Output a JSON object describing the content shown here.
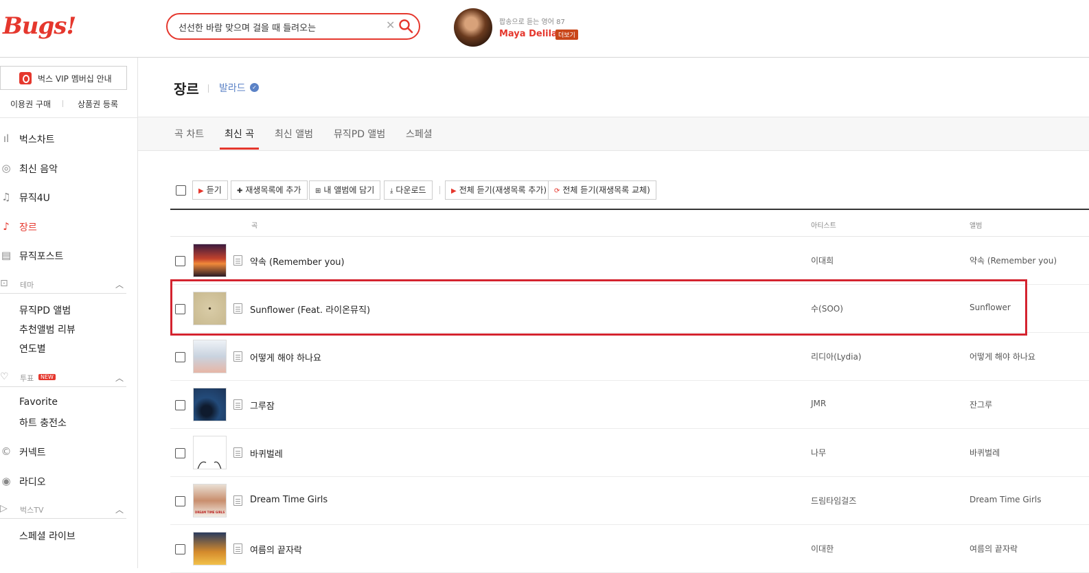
{
  "header": {
    "logo": "Bugs!",
    "search_value": "선선한 바람 맞으며 걸을 때 들려오는",
    "now_playing_sub": "팝송으로 듣는 영어 87",
    "now_playing_artist": "Maya Delilah",
    "now_playing_more": "더보기"
  },
  "sidebar": {
    "vip": "벅스 VIP 멤버십 안내",
    "buy_ticket": "이용권 구매",
    "register_ticket": "상품권 등록",
    "nav": [
      {
        "label": "벅스차트",
        "icon": "chart-icon"
      },
      {
        "label": "최신 음악",
        "icon": "new-music-icon"
      },
      {
        "label": "뮤직4U",
        "icon": "note-icon"
      },
      {
        "label": "장르",
        "icon": "guitar-icon"
      },
      {
        "label": "뮤직포스트",
        "icon": "post-icon"
      }
    ],
    "theme_label": "테마",
    "theme_items": [
      "뮤직PD 앨범",
      "추천앨범 리뷰",
      "연도별"
    ],
    "vote_label": "투표",
    "vote_badge": "NEW",
    "vote_items": [
      "Favorite",
      "하트 충전소"
    ],
    "connect": "커넥트",
    "radio": "라디오",
    "tv_label": "벅스TV",
    "tv_items": [
      "스페셜 라이브"
    ]
  },
  "main": {
    "title": "장르",
    "genre": "발라드",
    "tabs": [
      "곡 차트",
      "최신 곡",
      "최신 앨범",
      "뮤직PD 앨범",
      "스페셜"
    ],
    "active_tab": 1,
    "toolbar": {
      "listen": "듣기",
      "add_playlist": "재생목록에 추가",
      "add_album": "내 앨범에 담기",
      "download": "다운로드",
      "listen_all_add": "전체 듣기(재생목록 추가)",
      "listen_all_replace": "전체 듣기(재생목록 교체)"
    },
    "columns": {
      "title": "곡",
      "artist": "아티스트",
      "album": "앨범"
    },
    "rows": [
      {
        "title": "약속 (Remember you)",
        "artist": "이대희",
        "album": "약속 (Remember you)"
      },
      {
        "title": "Sunflower (Feat. 라이온뮤직)",
        "artist": "수(SOO)",
        "album": "Sunflower"
      },
      {
        "title": "어떻게 해야 하나요",
        "artist": "리디아(Lydia)",
        "album": "어떻게 해야 하나요"
      },
      {
        "title": "그루잠",
        "artist": "JMR",
        "album": "잔그루"
      },
      {
        "title": "바퀴벌레",
        "artist": "나무",
        "album": "바퀴벌레"
      },
      {
        "title": "Dream Time Girls",
        "artist": "드림타임걸즈",
        "album": "Dream Time Girls"
      },
      {
        "title": "여름의 끝자락",
        "artist": "이대한",
        "album": "여름의 끝자락"
      }
    ],
    "thumb_text_row6": "DREAM TIME GIRLS"
  },
  "colors": {
    "accent": "#e5372d",
    "highlight": "#d4232f",
    "genre": "#5b82c6"
  }
}
